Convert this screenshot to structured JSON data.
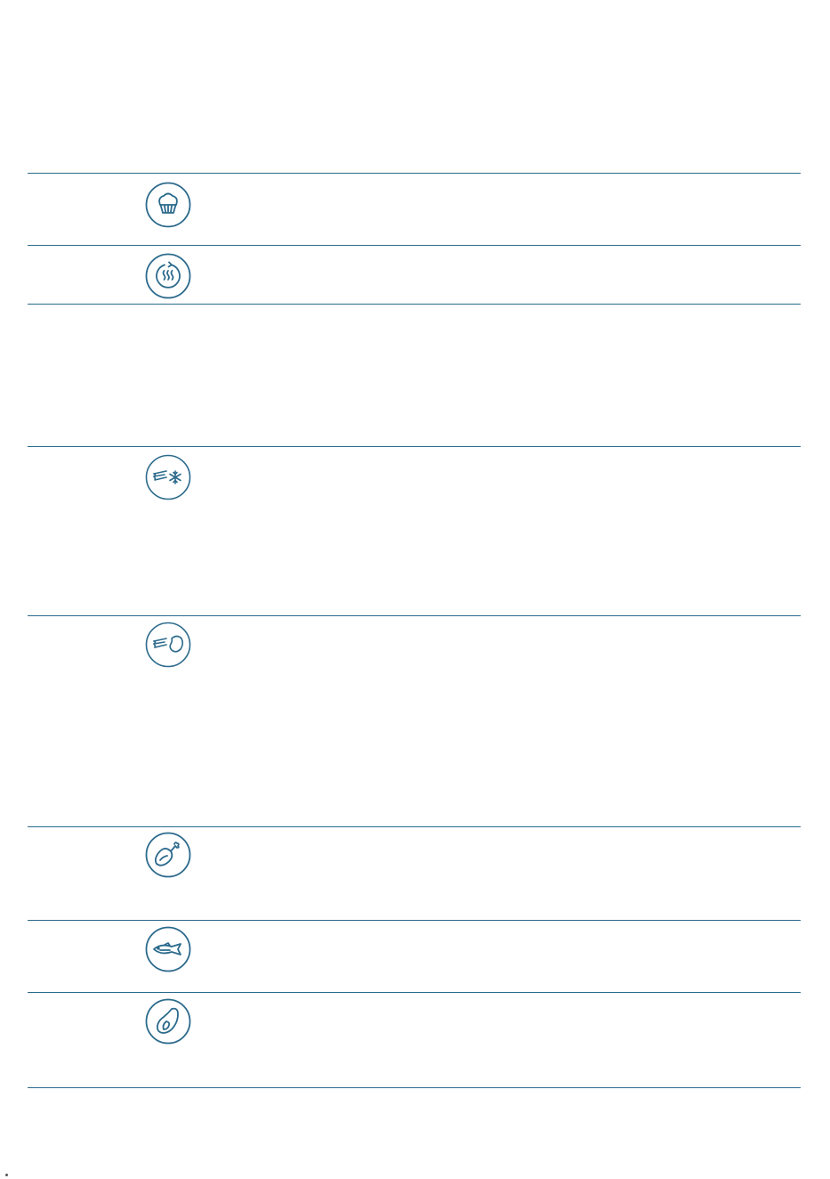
{
  "table": {
    "accent_color": "#2b6a8c",
    "rows": [
      {
        "icon": "muffin-icon"
      },
      {
        "icon": "keep-warm-icon"
      },
      {
        "icon": "none"
      },
      {
        "icon": "frozen-food-icon"
      },
      {
        "icon": "defrost-meat-icon"
      },
      {
        "icon": "poultry-leg-icon"
      },
      {
        "icon": "fish-icon"
      },
      {
        "icon": "meat-cut-icon"
      }
    ]
  }
}
